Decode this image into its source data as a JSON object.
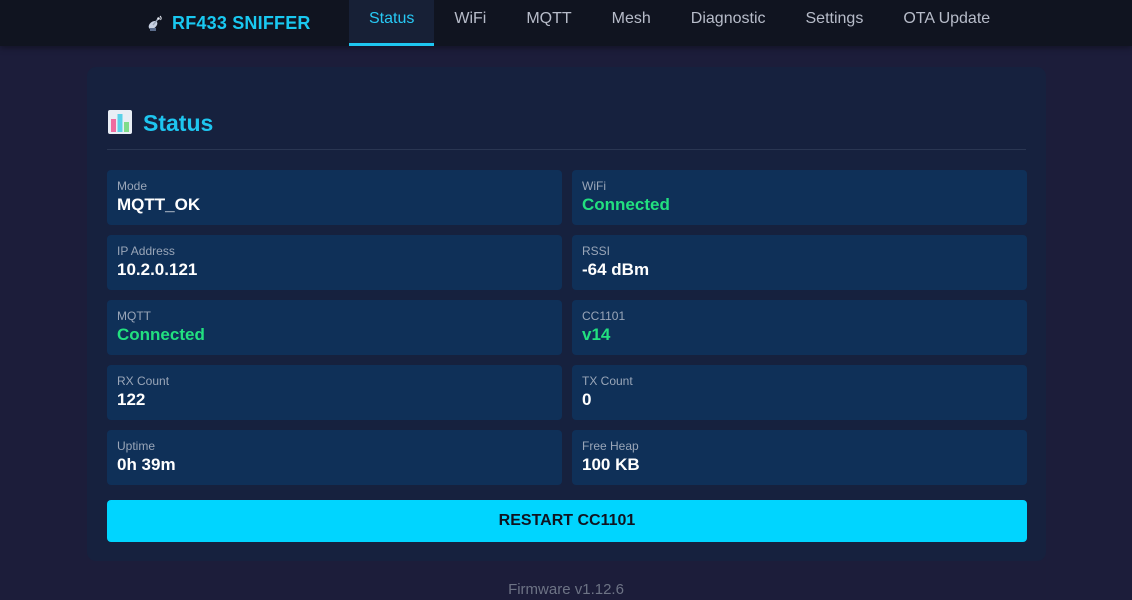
{
  "brand": {
    "title": "RF433 SNIFFER",
    "icon": "satellite-antenna-icon"
  },
  "nav": {
    "tabs": [
      {
        "label": "Status",
        "active": true
      },
      {
        "label": "WiFi",
        "active": false
      },
      {
        "label": "MQTT",
        "active": false
      },
      {
        "label": "Mesh",
        "active": false
      },
      {
        "label": "Diagnostic",
        "active": false
      },
      {
        "label": "Settings",
        "active": false
      },
      {
        "label": "OTA Update",
        "active": false
      }
    ]
  },
  "status": {
    "title": "Status",
    "icon": "bar-chart-icon",
    "tiles": [
      {
        "label": "Mode",
        "value": "MQTT_OK",
        "state": "normal"
      },
      {
        "label": "WiFi",
        "value": "Connected",
        "state": "ok"
      },
      {
        "label": "IP Address",
        "value": "10.2.0.121",
        "state": "normal"
      },
      {
        "label": "RSSI",
        "value": "-64 dBm",
        "state": "normal"
      },
      {
        "label": "MQTT",
        "value": "Connected",
        "state": "ok"
      },
      {
        "label": "CC1101",
        "value": "v14",
        "state": "ok"
      },
      {
        "label": "RX Count",
        "value": "122",
        "state": "normal"
      },
      {
        "label": "TX Count",
        "value": "0",
        "state": "normal"
      },
      {
        "label": "Uptime",
        "value": "0h 39m",
        "state": "normal"
      },
      {
        "label": "Free Heap",
        "value": "100 KB",
        "state": "normal"
      }
    ],
    "restart_label": "RESTART CC1101"
  },
  "footer": {
    "firmware": "Firmware v1.12.6"
  },
  "colors": {
    "accent": "#1ec6f0",
    "ok": "#22e07f",
    "button": "#00d5ff",
    "background": "#1c1d3a"
  }
}
